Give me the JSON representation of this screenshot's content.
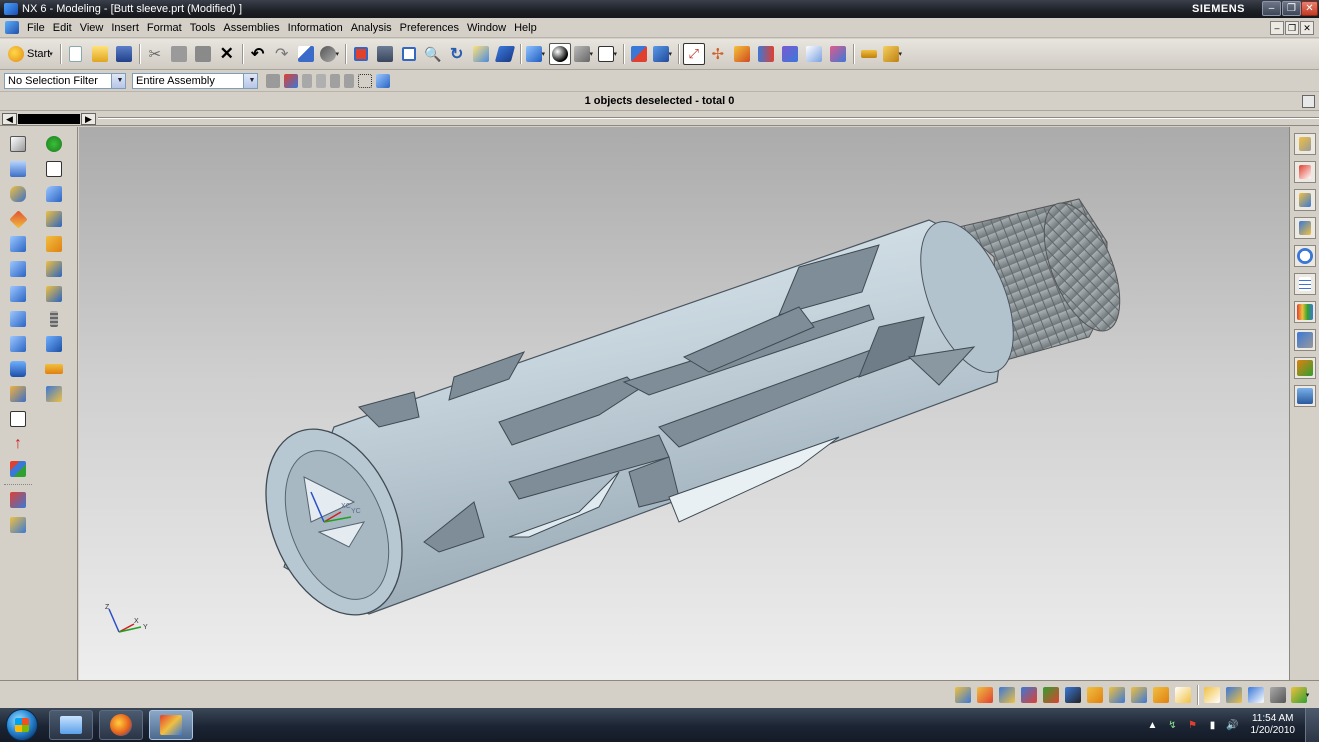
{
  "window": {
    "title": "NX 6 - Modeling - [Butt sleeve.prt (Modified) ]",
    "brand": "SIEMENS",
    "controls": [
      "–",
      "❐",
      "✕"
    ]
  },
  "menubar": {
    "items": [
      "File",
      "Edit",
      "View",
      "Insert",
      "Format",
      "Tools",
      "Assemblies",
      "Information",
      "Analysis",
      "Preferences",
      "Window",
      "Help"
    ],
    "mdi_controls": [
      "–",
      "❐",
      "✕"
    ]
  },
  "toolbar": {
    "start_label": "Start",
    "icons": [
      "start-icon",
      "new-icon",
      "open-icon",
      "save-icon",
      "cut-icon",
      "copy-icon",
      "paste-icon",
      "delete-icon",
      "undo-icon",
      "redo-icon",
      "repeat-command-icon",
      "selection-options-icon",
      "fit-icon",
      "zoom-window-icon",
      "zoom-icon",
      "zoom-realtime-icon",
      "rotate-icon",
      "pan-icon",
      "orient-view-icon",
      "rendering-style-icon",
      "shaded-icon",
      "edge-display-icon",
      "background-icon",
      "wcs-icon",
      "snap-view-icon",
      "sketch-icon",
      "datum-icon",
      "point-icon",
      "vector-icon",
      "csys-icon",
      "measure-distance-icon",
      "measure-icon"
    ]
  },
  "selection_bar": {
    "filter_value": "No Selection Filter",
    "scope_value": "Entire Assembly"
  },
  "status": {
    "message": "1 objects deselected  - total 0"
  },
  "viewport": {
    "wcs_labels": [
      "XC",
      "YC"
    ],
    "absolute_triad_labels": [
      "Z",
      "X",
      "Y"
    ],
    "model_color": "#c8d6e0",
    "thread_color": "#8e969a",
    "background_top": "#ababab",
    "background_bottom": "#eeeeee"
  },
  "taskbar": {
    "time": "11:54 AM",
    "date": "1/20/2010"
  }
}
